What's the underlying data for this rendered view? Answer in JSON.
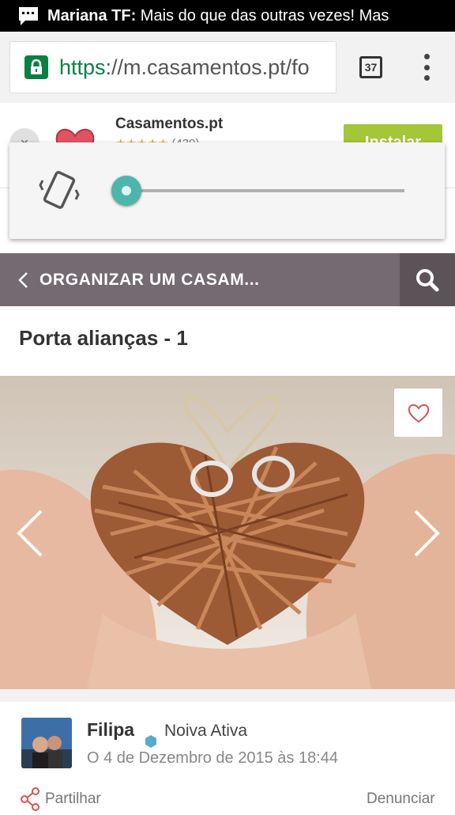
{
  "notification": {
    "sender": "Mariana TF:",
    "message": " Mais do que das outras vezes! Mas"
  },
  "browser": {
    "url_scheme": "https",
    "url_rest": "://m.casamentos.pt/fo",
    "tab_count": "37"
  },
  "app_banner": {
    "name": "Casamentos.pt",
    "stars": "★★★★★",
    "rating_count": "(439)",
    "install_label": "Instalar",
    "close_label": "×"
  },
  "volume_panel": {
    "level_fraction": 0.0,
    "mode": "vibrate"
  },
  "site_nav": {
    "title": "ORGANIZAR UM CASAM..."
  },
  "post": {
    "title": "Porta alianças - 1",
    "author": "Filipa",
    "badge": "Noiva Ativa",
    "date": "O 4 de Dezembro de 2015 às 18:44",
    "share_label": "Partilhar",
    "report_label": "Denunciar"
  },
  "colors": {
    "brand_nav": "#736b71",
    "install_green": "#a4c639",
    "secure_green": "#0b8043",
    "badge": "#5aa9c9",
    "slider": "#4db6ac"
  },
  "icons": [
    "chat-icon",
    "lock-icon",
    "vibrate-icon",
    "back-chevron-icon",
    "search-icon",
    "heart-icon",
    "chevron-left-icon",
    "chevron-right-icon",
    "share-icon"
  ]
}
